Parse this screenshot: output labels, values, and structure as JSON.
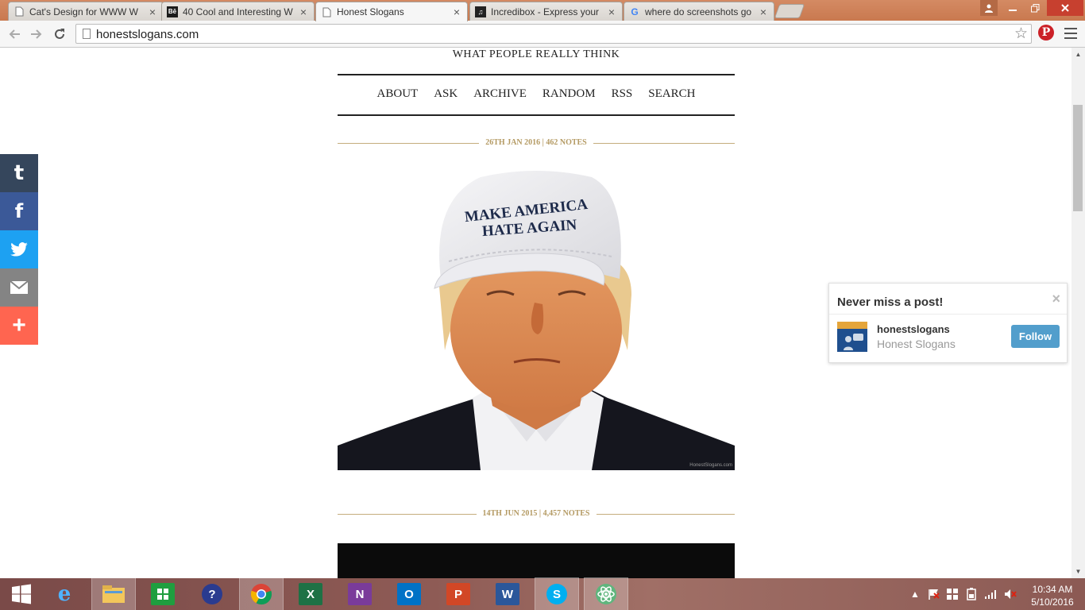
{
  "browser": {
    "tabs": [
      {
        "label": "Cat's Design for WWW W",
        "favicon": "page-icon"
      },
      {
        "label": "40 Cool and Interesting W",
        "favicon": "behance-icon",
        "favicon_text": "Bē"
      },
      {
        "label": "Honest Slogans",
        "favicon": "page-icon",
        "active": true
      },
      {
        "label": "Incredibox - Express your",
        "favicon": "music-icon",
        "favicon_text": "♫"
      },
      {
        "label": "where do screenshots go",
        "favicon": "google-icon",
        "favicon_text": "G"
      }
    ],
    "tab_close_glyph": "×",
    "url": "honestslogans.com"
  },
  "page": {
    "tagline": "WHAT PEOPLE REALLY THINK",
    "nav": [
      "ABOUT",
      "ASK",
      "ARCHIVE",
      "RANDOM",
      "RSS",
      "SEARCH"
    ],
    "posts": [
      {
        "meta": "26TH JAN 2016 | 462 NOTES",
        "cap_line1": "MAKE AMERICA",
        "cap_line2": "HATE AGAIN",
        "credit": "HonestSlogans.com"
      },
      {
        "meta": "14TH JUN 2015 | 4,457 NOTES"
      }
    ]
  },
  "share": {
    "tumblr": "t",
    "facebook": "f",
    "plus": "+"
  },
  "popup": {
    "title": "Never miss a post!",
    "close": "×",
    "blog_name": "honestslogans",
    "blog_title": "Honest Slogans",
    "follow_label": "Follow",
    "accent": "#529ecc"
  },
  "taskbar": {
    "time": "10:34 AM",
    "date": "5/10/2016",
    "apps": [
      "start",
      "internet-explorer",
      "file-explorer",
      "store",
      "help",
      "chrome",
      "excel",
      "onenote",
      "outlook",
      "powerpoint",
      "word",
      "skype",
      "atom"
    ]
  },
  "colors": {
    "meta_gold": "#b49a63",
    "tumblr": "#35465c",
    "facebook": "#3b5998",
    "twitter": "#1da1f2",
    "mail": "#848484",
    "addthis": "#ff6550"
  }
}
